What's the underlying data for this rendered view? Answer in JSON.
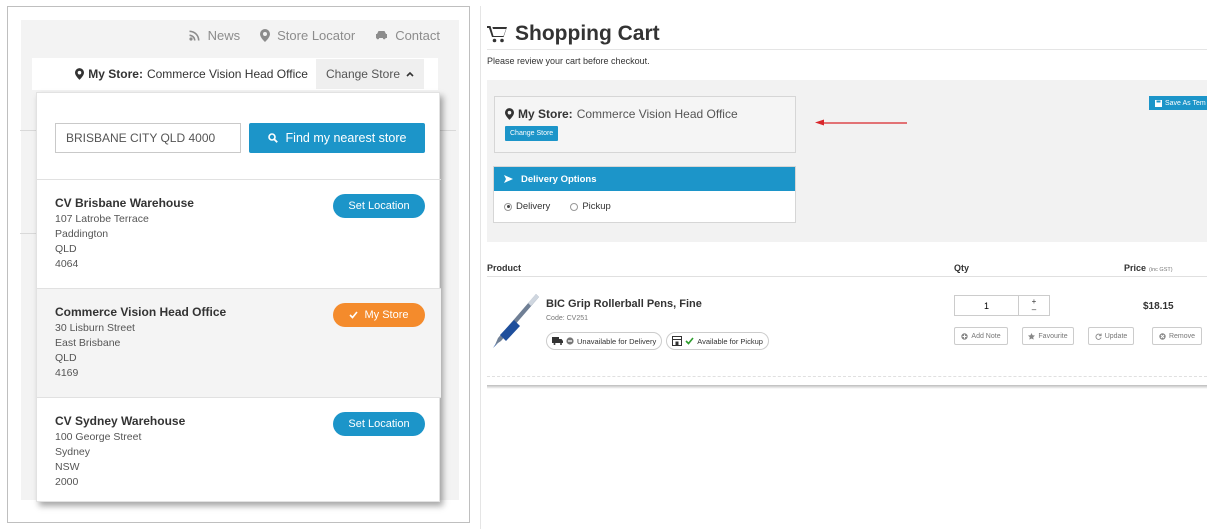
{
  "left": {
    "nav": [
      {
        "label": "News",
        "icon": "rss-icon"
      },
      {
        "label": "Store Locator",
        "icon": "map-pin-icon"
      },
      {
        "label": "Contact",
        "icon": "car-icon"
      }
    ],
    "store_bar": {
      "label": "My Store:",
      "value": "Commerce Vision Head Office",
      "change": "Change Store"
    },
    "search": {
      "value": "BRISBANE CITY QLD 4000",
      "button": "Find my nearest store"
    },
    "stores": [
      {
        "name": "CV Brisbane Warehouse",
        "line1": "107 Latrobe Terrace",
        "line2": "Paddington",
        "state": "QLD",
        "postcode": "4064",
        "button": "Set Location"
      },
      {
        "name": "Commerce Vision Head Office",
        "line1": "30 Lisburn Street",
        "line2": "East Brisbane",
        "state": "QLD",
        "postcode": "4169",
        "button": "My Store"
      },
      {
        "name": "CV Sydney Warehouse",
        "line1": "100 George Street",
        "line2": "Sydney",
        "state": "NSW",
        "postcode": "2000",
        "button": "Set Location"
      }
    ]
  },
  "cart": {
    "title": "Shopping Cart",
    "subtitle": "Please review your cart before checkout.",
    "my_store_label": "My Store:",
    "my_store_value": "Commerce Vision Head Office",
    "change_store": "Change Store",
    "save_template": "Save As Tem",
    "delivery": {
      "title": "Delivery Options",
      "options": [
        "Delivery",
        "Pickup"
      ],
      "selected": "Delivery"
    },
    "headers": {
      "product": "Product",
      "qty": "Qty",
      "price": "Price",
      "price_note": "(inc GST)"
    },
    "item": {
      "name": "BIC Grip Rollerball Pens, Fine",
      "code": "Code: CV251",
      "delivery_status": "Unavailable for Delivery",
      "pickup_status": "Available for Pickup",
      "qty": "1",
      "price": "$18.15",
      "actions": [
        "Add Note",
        "Favourite",
        "Update",
        "Remove"
      ]
    }
  },
  "colors": {
    "primary": "#1c95c9",
    "accent": "#f48b2c",
    "green": "#2e9e2e",
    "arrow": "#d9262b"
  }
}
